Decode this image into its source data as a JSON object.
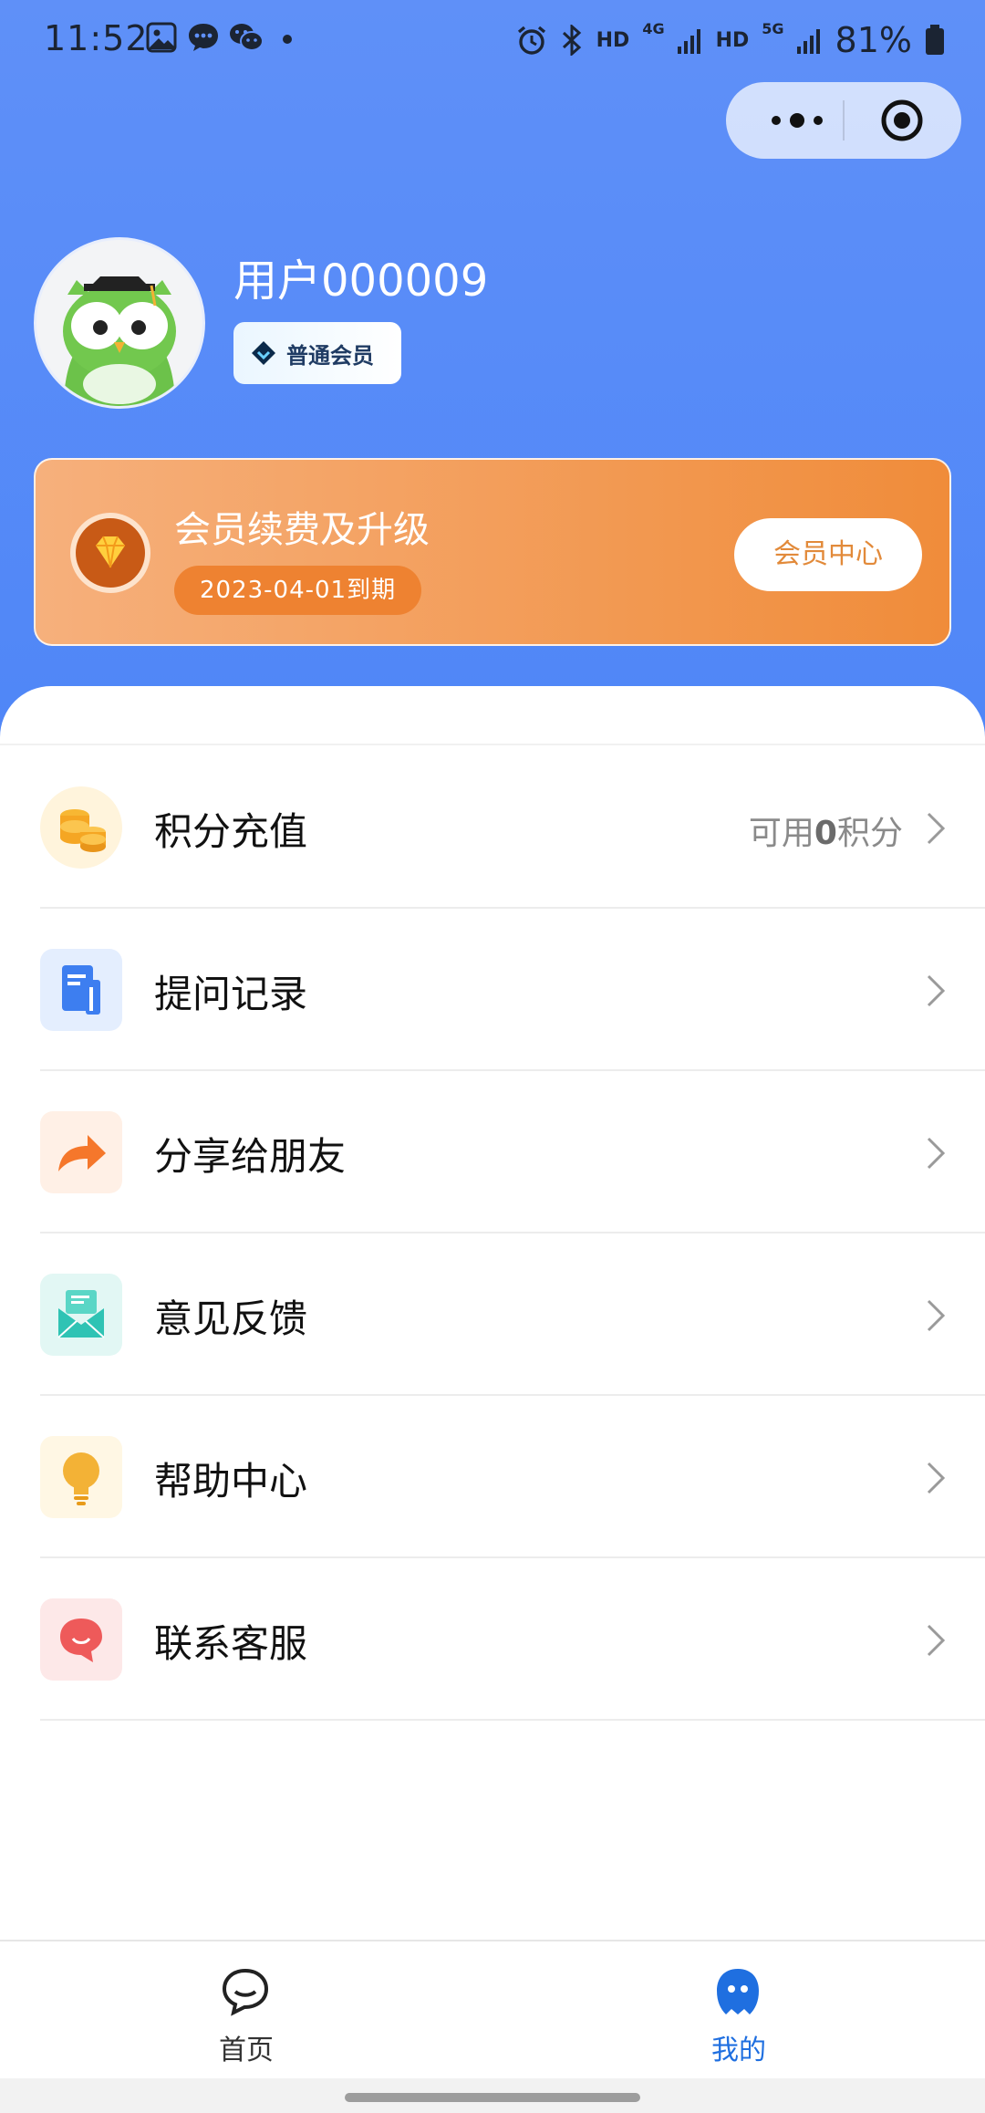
{
  "status_bar": {
    "time": "11:52",
    "network_labels": [
      "HD",
      "4G",
      "HD",
      "5G"
    ],
    "battery": "81%",
    "icons": [
      "gallery-icon",
      "message-icon",
      "wechat-icon",
      "dot-icon",
      "alarm-icon",
      "bluetooth-icon",
      "signal-icon",
      "battery-icon"
    ]
  },
  "capsule": {
    "more_icon": "more-icon",
    "close_icon": "target-icon"
  },
  "profile": {
    "username": "用户000009",
    "member_level": "普通会员",
    "avatar_icon": "owl-avatar-icon"
  },
  "vip_card": {
    "title": "会员续费及升级",
    "expire": "2023-04-01到期",
    "button": "会员中心",
    "icon": "diamond-icon"
  },
  "menu": {
    "items": [
      {
        "label": "积分充值",
        "icon": "coins-icon",
        "extra_prefix": "可用",
        "extra_value": "0",
        "extra_suffix": "积分",
        "color": "#f5a623"
      },
      {
        "label": "提问记录",
        "icon": "document-icon",
        "color": "#3d7ef0"
      },
      {
        "label": "分享给朋友",
        "icon": "share-icon",
        "color": "#f5772b"
      },
      {
        "label": "意见反馈",
        "icon": "mail-icon",
        "color": "#2fc3b4"
      },
      {
        "label": "帮助中心",
        "icon": "lightbulb-icon",
        "color": "#f3b236"
      },
      {
        "label": "联系客服",
        "icon": "chat-bubble-icon",
        "color": "#ee5a5a"
      }
    ]
  },
  "tabbar": {
    "tabs": [
      {
        "label": "首页",
        "icon": "chat-icon",
        "active": false
      },
      {
        "label": "我的",
        "icon": "profile-icon",
        "active": true
      }
    ],
    "active_color": "#1f6fe0",
    "inactive_color": "#333333"
  }
}
